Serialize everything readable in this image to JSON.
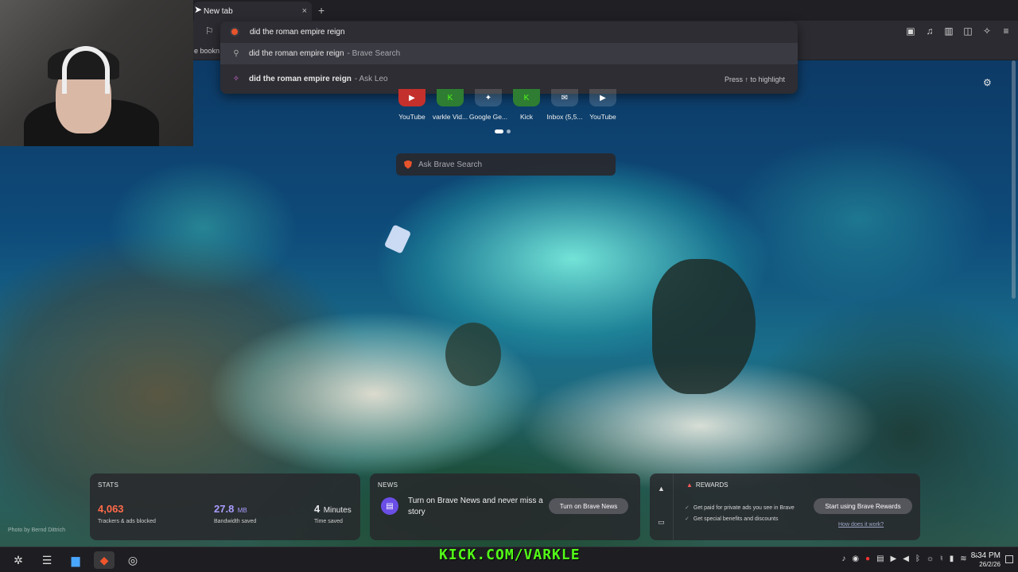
{
  "tab": {
    "title": "New tab",
    "close": "×",
    "new_tab": "+"
  },
  "bookmarks_bar": {
    "label": "e bookn"
  },
  "omnibox": {
    "value": "did the roman empire reign ",
    "suggestions": [
      {
        "main": "did the roman empire reign",
        "sub": "- Brave Search",
        "icon": "search-icon"
      },
      {
        "main": "did the roman empire reign",
        "sub": "- Ask Leo",
        "icon": "leo-icon",
        "hint": "Press ↑ to highlight"
      }
    ]
  },
  "top_sites": [
    {
      "name": "YouTube",
      "glyph": "▶"
    },
    {
      "name": "varkle Vid...",
      "glyph": "K"
    },
    {
      "name": "Google Ge...",
      "glyph": "✦"
    },
    {
      "name": "Kick",
      "glyph": "K"
    },
    {
      "name": "Inbox (5,5...",
      "glyph": "✉"
    },
    {
      "name": "YouTube",
      "glyph": "▶"
    }
  ],
  "search_box": {
    "placeholder": "Ask Brave Search"
  },
  "stats": {
    "title": "STATS",
    "trackers": {
      "value": "4,063",
      "label": "Trackers & ads blocked",
      "color": "#ff6b4a"
    },
    "bandwidth": {
      "value": "27.8",
      "unit": "MB",
      "label": "Bandwidth saved",
      "color": "#a99cff"
    },
    "time": {
      "value": "4",
      "unit": "Minutes",
      "label": "Time saved",
      "color": "#ffffff"
    }
  },
  "news": {
    "title": "NEWS",
    "text": "Turn on Brave News and never miss a story",
    "button": "Turn on Brave News"
  },
  "rewards": {
    "title": "REWARDS",
    "items": [
      "Get paid for private ads you see in Brave",
      "Get special benefits and discounts"
    ],
    "button": "Start using Brave Rewards",
    "link": "How does it work?"
  },
  "photo_credit": "Photo by Bernd Dittrich",
  "overlay_text": "KICK.COM/VARKLE",
  "clock": {
    "time": "8:34 PM",
    "date": "26/2/26"
  }
}
